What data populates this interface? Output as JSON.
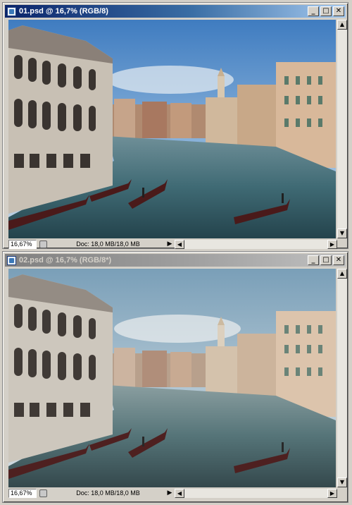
{
  "windows": [
    {
      "title": "01.psd @ 16,7% (RGB/8)",
      "active": true,
      "zoom": "16,67%",
      "doc_info": "Doc: 18,0 MB/18,0 MB"
    },
    {
      "title": "02.psd @ 16,7% (RGB/8*)",
      "active": false,
      "zoom": "16,67%",
      "doc_info": "Doc: 18,0 MB/18,0 MB"
    }
  ],
  "icons": {
    "app": "photoshop-document-icon",
    "minimize": "minimize-icon",
    "maximize": "maximize-icon",
    "close": "close-icon",
    "scroll_up": "arrow-up-icon",
    "scroll_down": "arrow-down-icon",
    "scroll_left": "arrow-left-icon",
    "scroll_right": "arrow-right-icon",
    "status_menu": "play-triangle-icon"
  },
  "colors": {
    "active_title": "#0a246a",
    "inactive_title": "#808080",
    "chrome": "#d4d0c8"
  }
}
